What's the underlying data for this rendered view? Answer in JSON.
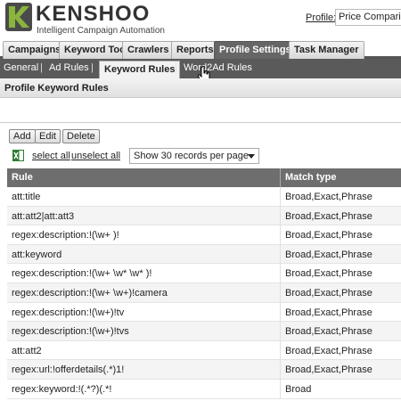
{
  "header": {
    "brand": "KENSHOO",
    "tagline": "Intelligent Campaign Automation",
    "profile_label": "Profile:",
    "profile_value": "Price Comparise"
  },
  "main_tabs": [
    "Campaigns",
    "Keyword Tool",
    "Crawlers",
    "Reports",
    "Profile Settings",
    "Task Manager"
  ],
  "sub_tabs": {
    "general": "General",
    "ad_rules": "Ad Rules",
    "keyword_rules": "Keyword Rules",
    "word2ad_rules": "Word2Ad Rules",
    "separator": "|"
  },
  "page_title": "Profile Keyword Rules",
  "toolbar": {
    "add": "Add",
    "edit": "Edit",
    "delete": "Delete",
    "select_all": "select all",
    "unselect_all": "unselect all",
    "per_page": "Show 30 records per page"
  },
  "table": {
    "columns": [
      "Rule",
      "Match type"
    ],
    "rows": [
      [
        "att:title",
        "Broad,Exact,Phrase"
      ],
      [
        "att:att2|att:att3",
        "Broad,Exact,Phrase"
      ],
      [
        "regex:description:!(\\w+ )!",
        "Broad,Exact,Phrase"
      ],
      [
        "att:keyword",
        "Broad,Exact,Phrase"
      ],
      [
        "regex:description:!(\\w+ \\w* \\w* )!",
        "Broad,Exact,Phrase"
      ],
      [
        "regex:description:!(\\w+ \\w+)!camera",
        "Broad,Exact,Phrase"
      ],
      [
        "regex:description:!(\\w+)!tv",
        "Broad,Exact,Phrase"
      ],
      [
        "regex:description:!(\\w+)!tvs",
        "Broad,Exact,Phrase"
      ],
      [
        "att:att2",
        "Broad,Exact,Phrase"
      ],
      [
        "regex:url:!offerdetails(.*)1!",
        "Broad,Exact,Phrase"
      ],
      [
        "regex:keyword:!(.*?)(.*!",
        "Broad"
      ]
    ]
  },
  "colors": {
    "active_main_tab": "#666666",
    "sub_bar": "#5a5a5a",
    "table_header": "#6e6e6e",
    "logo_green": "#8ab43c"
  }
}
